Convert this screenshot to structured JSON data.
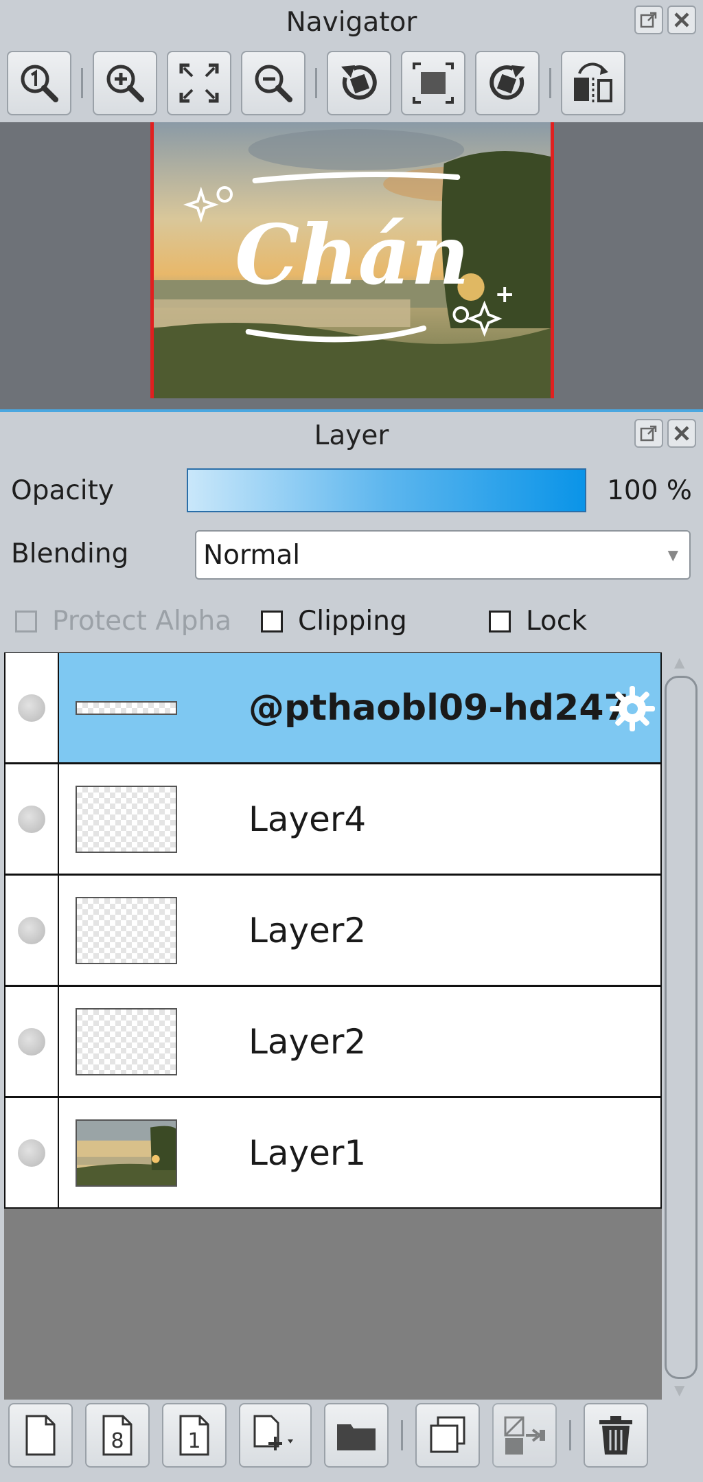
{
  "navigator": {
    "title": "Navigator",
    "toolbar_icons": [
      "zoom-actual-icon",
      "zoom-in-icon",
      "fit-screen-icon",
      "zoom-out-icon",
      "rotate-left-icon",
      "fit-frame-icon",
      "rotate-right-icon",
      "flip-horizontal-icon"
    ],
    "preview_text": "Chán"
  },
  "layer_panel": {
    "title": "Layer",
    "opacity_label": "Opacity",
    "opacity_value": "100 %",
    "opacity": 1.0,
    "blending_label": "Blending",
    "blending_value": "Normal",
    "checkboxes": [
      {
        "label": "Protect Alpha",
        "checked": false,
        "enabled": false
      },
      {
        "label": "Clipping",
        "checked": false,
        "enabled": true
      },
      {
        "label": "Lock",
        "checked": false,
        "enabled": true
      }
    ],
    "layers": [
      {
        "name": "@pthaobl09-hd247",
        "selected": true,
        "thumb": "thin"
      },
      {
        "name": "Layer4",
        "selected": false,
        "thumb": "transparent"
      },
      {
        "name": "Layer2",
        "selected": false,
        "thumb": "transparent"
      },
      {
        "name": "Layer2",
        "selected": false,
        "thumb": "transparent"
      },
      {
        "name": "Layer1",
        "selected": false,
        "thumb": "photo"
      }
    ],
    "bottom_icons": [
      "new-layer-icon",
      "new-8bit-layer-icon",
      "new-1bit-layer-icon",
      "add-layer-menu-icon",
      "new-folder-icon",
      "duplicate-layer-icon",
      "merge-down-icon",
      "delete-layer-icon"
    ]
  },
  "colors": {
    "accent": "#0a94e8",
    "selected_row": "#7ec8f2",
    "navigator_frame": "#e02020",
    "panel_bg": "#c9ced4"
  }
}
